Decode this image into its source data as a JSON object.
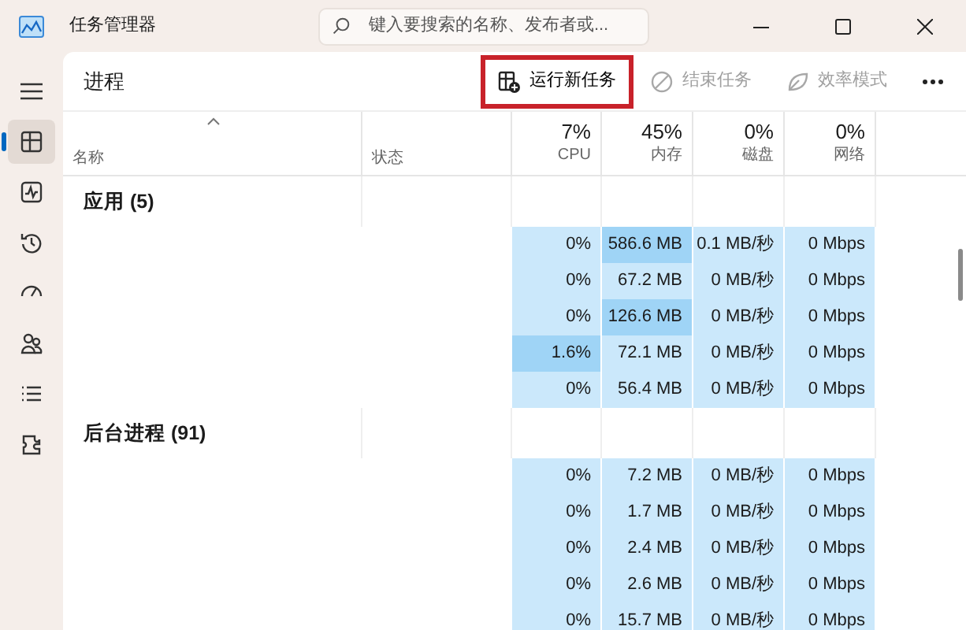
{
  "window": {
    "title": "任务管理器"
  },
  "search": {
    "placeholder": "键入要搜索的名称、发布者或..."
  },
  "sidebar": {
    "items": [
      {
        "kind": "processes",
        "selected": true
      },
      {
        "kind": "performance",
        "selected": false
      },
      {
        "kind": "history",
        "selected": false
      },
      {
        "kind": "startup",
        "selected": false
      },
      {
        "kind": "users",
        "selected": false
      },
      {
        "kind": "details",
        "selected": false
      },
      {
        "kind": "services",
        "selected": false
      }
    ]
  },
  "page_title": "进程",
  "toolbar": [
    {
      "kind": "run",
      "label": "运行新任务",
      "disabled": false,
      "outlined": true
    },
    {
      "kind": "end",
      "label": "结束任务",
      "disabled": true,
      "outlined": false
    },
    {
      "kind": "efficiency",
      "label": "效率模式",
      "disabled": true,
      "outlined": false
    }
  ],
  "table": {
    "columns": [
      {
        "label": "名称",
        "sorted": true
      },
      {
        "label": "状态",
        "sorted": false
      },
      {
        "percent": "7%",
        "label": "CPU",
        "sorted": false
      },
      {
        "percent": "45%",
        "label": "内存",
        "sorted": false
      },
      {
        "percent": "0%",
        "label": "磁盘",
        "sorted": false
      },
      {
        "percent": "0%",
        "label": "网络",
        "sorted": false
      }
    ],
    "groups": [
      {
        "title": "应用 (5)",
        "rows": [
          {
            "cells": [
              {
                "text": "0%",
                "high": false
              },
              {
                "text": "586.6 MB",
                "high": true
              },
              {
                "text": "0.1 MB/秒",
                "high": false
              },
              {
                "text": "0 Mbps",
                "high": false
              }
            ]
          },
          {
            "cells": [
              {
                "text": "0%",
                "high": false
              },
              {
                "text": "67.2 MB",
                "high": false
              },
              {
                "text": "0 MB/秒",
                "high": false
              },
              {
                "text": "0 Mbps",
                "high": false
              }
            ]
          },
          {
            "cells": [
              {
                "text": "0%",
                "high": false
              },
              {
                "text": "126.6 MB",
                "high": true
              },
              {
                "text": "0 MB/秒",
                "high": false
              },
              {
                "text": "0 Mbps",
                "high": false
              }
            ]
          },
          {
            "cells": [
              {
                "text": "1.6%",
                "high": true
              },
              {
                "text": "72.1 MB",
                "high": false
              },
              {
                "text": "0 MB/秒",
                "high": false
              },
              {
                "text": "0 Mbps",
                "high": false
              }
            ]
          },
          {
            "cells": [
              {
                "text": "0%",
                "high": false
              },
              {
                "text": "56.4 MB",
                "high": false
              },
              {
                "text": "0 MB/秒",
                "high": false
              },
              {
                "text": "0 Mbps",
                "high": false
              }
            ]
          }
        ]
      },
      {
        "title": "后台进程 (91)",
        "rows": [
          {
            "cells": [
              {
                "text": "0%",
                "high": false
              },
              {
                "text": "7.2 MB",
                "high": false
              },
              {
                "text": "0 MB/秒",
                "high": false
              },
              {
                "text": "0 Mbps",
                "high": false
              }
            ]
          },
          {
            "cells": [
              {
                "text": "0%",
                "high": false
              },
              {
                "text": "1.7 MB",
                "high": false
              },
              {
                "text": "0 MB/秒",
                "high": false
              },
              {
                "text": "0 Mbps",
                "high": false
              }
            ]
          },
          {
            "cells": [
              {
                "text": "0%",
                "high": false
              },
              {
                "text": "2.4 MB",
                "high": false
              },
              {
                "text": "0 MB/秒",
                "high": false
              },
              {
                "text": "0 Mbps",
                "high": false
              }
            ]
          },
          {
            "cells": [
              {
                "text": "0%",
                "high": false
              },
              {
                "text": "2.6 MB",
                "high": false
              },
              {
                "text": "0 MB/秒",
                "high": false
              },
              {
                "text": "0 Mbps",
                "high": false
              }
            ]
          },
          {
            "cells": [
              {
                "text": "0%",
                "high": false
              },
              {
                "text": "15.7 MB",
                "high": false
              },
              {
                "text": "0 MB/秒",
                "high": false
              },
              {
                "text": "0 Mbps",
                "high": false
              }
            ]
          }
        ]
      }
    ]
  }
}
